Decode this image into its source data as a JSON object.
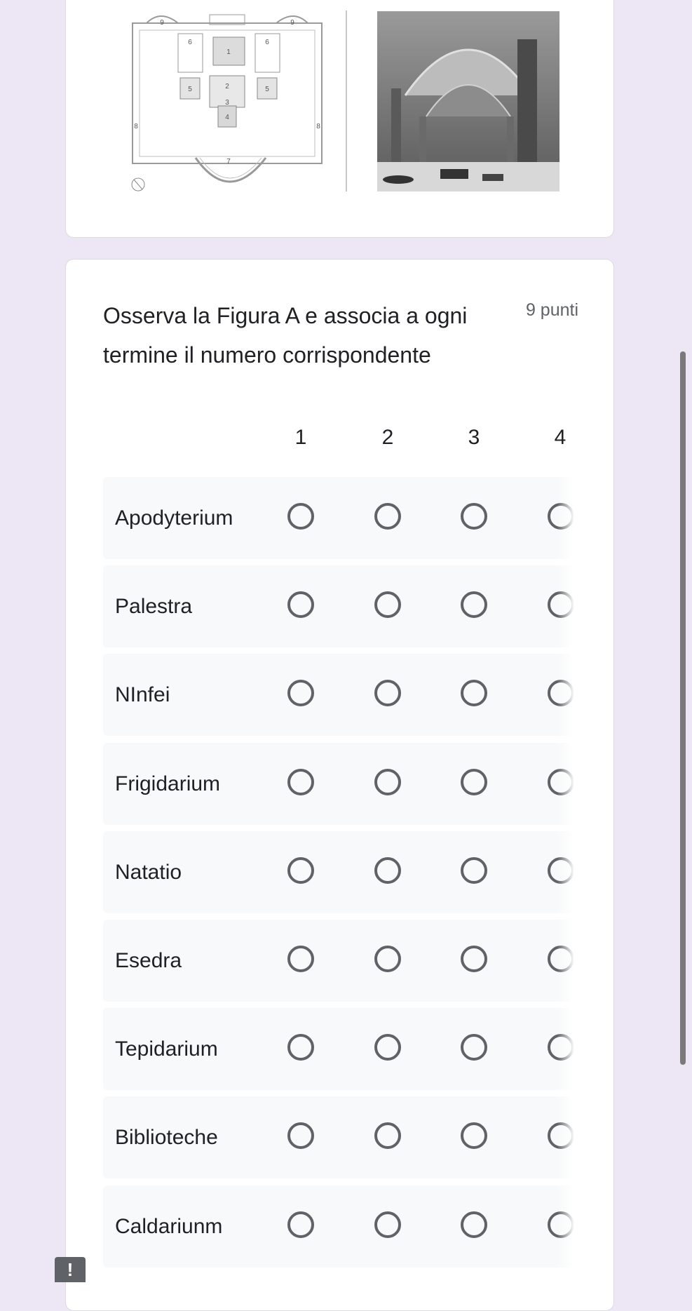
{
  "figure": {
    "plan_labels": [
      "9",
      "9",
      "6",
      "1",
      "6",
      "5",
      "2",
      "5",
      "3",
      "4",
      "8",
      "8",
      "7"
    ]
  },
  "question": {
    "title": "Osserva la Figura A e associa a ogni termine il numero corrispondente",
    "points": "9 punti",
    "columns": [
      "1",
      "2",
      "3",
      "4"
    ],
    "rows": [
      {
        "label": "Apodyterium"
      },
      {
        "label": "Palestra"
      },
      {
        "label": "NInfei"
      },
      {
        "label": "Frigidarium"
      },
      {
        "label": "Natatio"
      },
      {
        "label": "Esedra"
      },
      {
        "label": "Tepidarium"
      },
      {
        "label": "Biblioteche"
      },
      {
        "label": "Caldariunm"
      }
    ]
  },
  "badge": {
    "text": "!"
  }
}
